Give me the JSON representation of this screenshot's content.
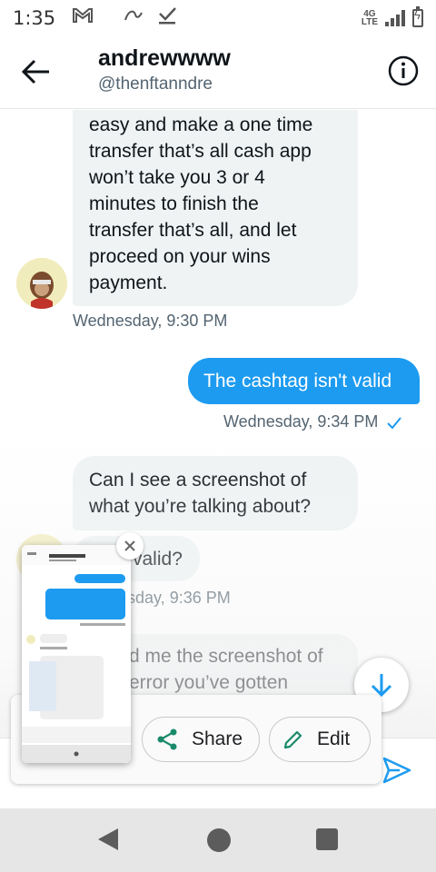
{
  "status_bar": {
    "time": "1:35",
    "icons": [
      "gmail-icon",
      "messaging-icon",
      "download-check-icon"
    ],
    "network": "4G LTE"
  },
  "header": {
    "name": "andrewwww",
    "handle": "@thenftanndre"
  },
  "messages": [
    {
      "direction": "incoming",
      "lines": [
        "easy and make a one time",
        "transfer that’s all cash app",
        "won’t take you 3 or 4",
        "minutes to finish the",
        "transfer that’s all, and let",
        "proceed on your wins",
        "payment."
      ],
      "timestamp": "Wednesday, 9:30 PM"
    },
    {
      "direction": "outgoing",
      "text": "The cashtag isn't valid",
      "timestamp": "Wednesday, 9:34 PM"
    },
    {
      "direction": "incoming",
      "lines": [
        "Can I see a screenshot of",
        "what you’re talking about?"
      ]
    },
    {
      "direction": "incoming",
      "text_partial": "valid?",
      "timestamp_partial": "sday, 9:36 PM"
    },
    {
      "direction": "incoming",
      "lines_partial": [
        "d me the screenshot of",
        "error you’ve gotten"
      ]
    }
  ],
  "screenshot_actions": {
    "share_label": "Share",
    "edit_label": "Edit"
  },
  "colors": {
    "accent": "#1d9bf0",
    "incoming_bubble": "#eff3f4",
    "timestamp": "#536471"
  }
}
